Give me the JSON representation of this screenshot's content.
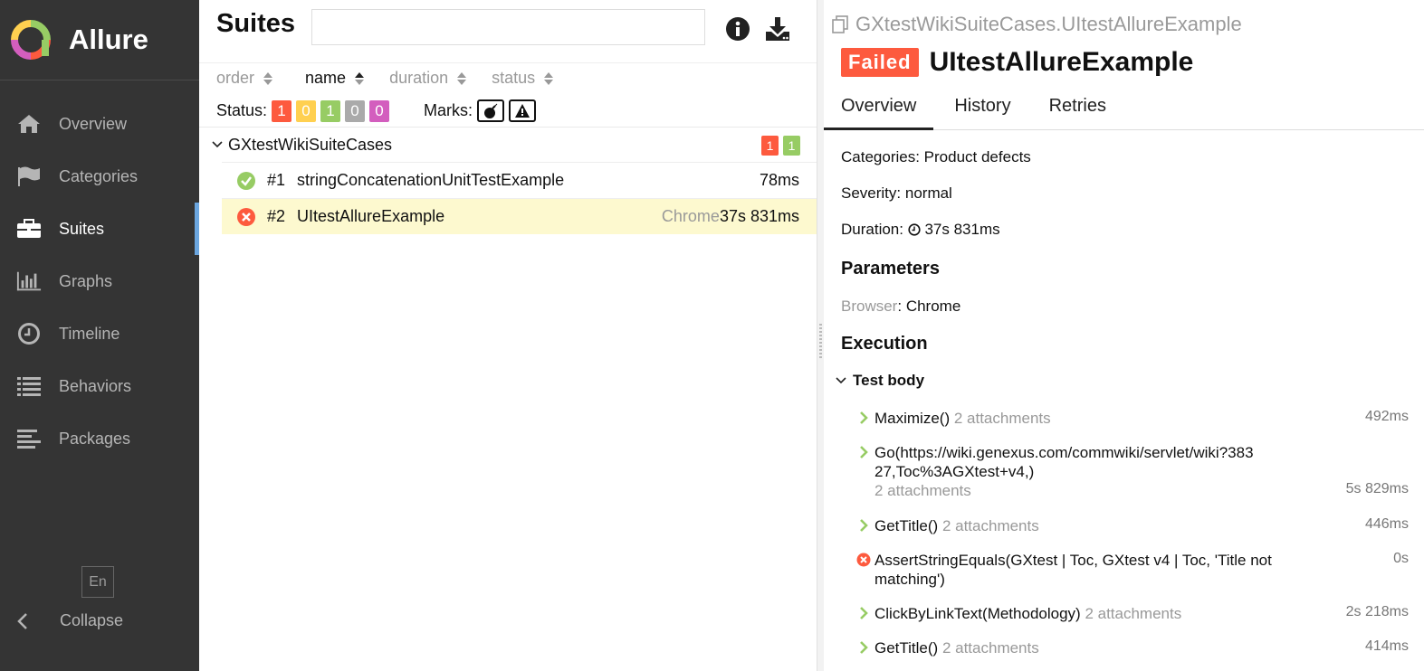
{
  "brand": {
    "name": "Allure"
  },
  "sidebar": {
    "items": [
      {
        "label": "Overview",
        "icon": "home-icon"
      },
      {
        "label": "Categories",
        "icon": "flag-icon"
      },
      {
        "label": "Suites",
        "icon": "briefcase-icon"
      },
      {
        "label": "Graphs",
        "icon": "bar-chart-icon"
      },
      {
        "label": "Timeline",
        "icon": "clock-icon"
      },
      {
        "label": "Behaviors",
        "icon": "list-icon"
      },
      {
        "label": "Packages",
        "icon": "align-left-icon"
      }
    ],
    "active_item": "Suites",
    "language": "En",
    "collapse_label": "Collapse"
  },
  "suites": {
    "title": "Suites",
    "search": {
      "value": "",
      "placeholder": ""
    },
    "sort": [
      "order",
      "name",
      "duration",
      "status"
    ],
    "status_label": "Status:",
    "status_counts": [
      {
        "value": "1",
        "color": "#fd5a3e"
      },
      {
        "value": "0",
        "color": "#ffd050"
      },
      {
        "value": "1",
        "color": "#97cc64"
      },
      {
        "value": "0",
        "color": "#aaaaaa"
      },
      {
        "value": "0",
        "color": "#d35ebe"
      }
    ],
    "marks_label": "Marks:",
    "group": {
      "name": "GXtestWikiSuiteCases",
      "failed": "1",
      "passed": "1"
    },
    "tests": [
      {
        "num": "#1",
        "name": "stringConcatenationUnitTestExample",
        "param": "",
        "duration": "78ms",
        "status": "passed"
      },
      {
        "num": "#2",
        "name": "UItestAllureExample",
        "param": "Chrome",
        "duration": "37s 831ms",
        "status": "failed"
      }
    ]
  },
  "detail": {
    "breadcrumb": "GXtestWikiSuiteCases.UItestAllureExample",
    "status": "Failed",
    "title": "UItestAllureExample",
    "tabs": [
      "Overview",
      "History",
      "Retries"
    ],
    "categories_label": "Categories:",
    "categories_value": "Product defects",
    "severity_label": "Severity:",
    "severity_value": "normal",
    "duration_label": "Duration:",
    "duration_value": "37s 831ms",
    "parameters_heading": "Parameters",
    "param_name": "Browser",
    "param_value": "Chrome",
    "execution_heading": "Execution",
    "test_body_label": "Test body",
    "steps": [
      {
        "name": "Maximize()",
        "attachments": "2 attachments",
        "duration": "492ms",
        "status": "passed"
      },
      {
        "name": "Go(https://wiki.genexus.com/commwiki/servlet/wiki?38327,Toc%3AGXtest+v4,)",
        "attachments": "2 attachments",
        "duration": "5s 829ms",
        "status": "passed"
      },
      {
        "name": "GetTitle()",
        "attachments": "2 attachments",
        "duration": "446ms",
        "status": "passed"
      },
      {
        "name": "AssertStringEquals(GXtest | Toc, GXtest v4 | Toc, 'Title not matching')",
        "attachments": "",
        "duration": "0s",
        "status": "failed"
      },
      {
        "name": "ClickByLinkText(Methodology)",
        "attachments": "2 attachments",
        "duration": "2s 218ms",
        "status": "passed"
      },
      {
        "name": "GetTitle()",
        "attachments": "2 attachments",
        "duration": "414ms",
        "status": "passed"
      }
    ]
  }
}
